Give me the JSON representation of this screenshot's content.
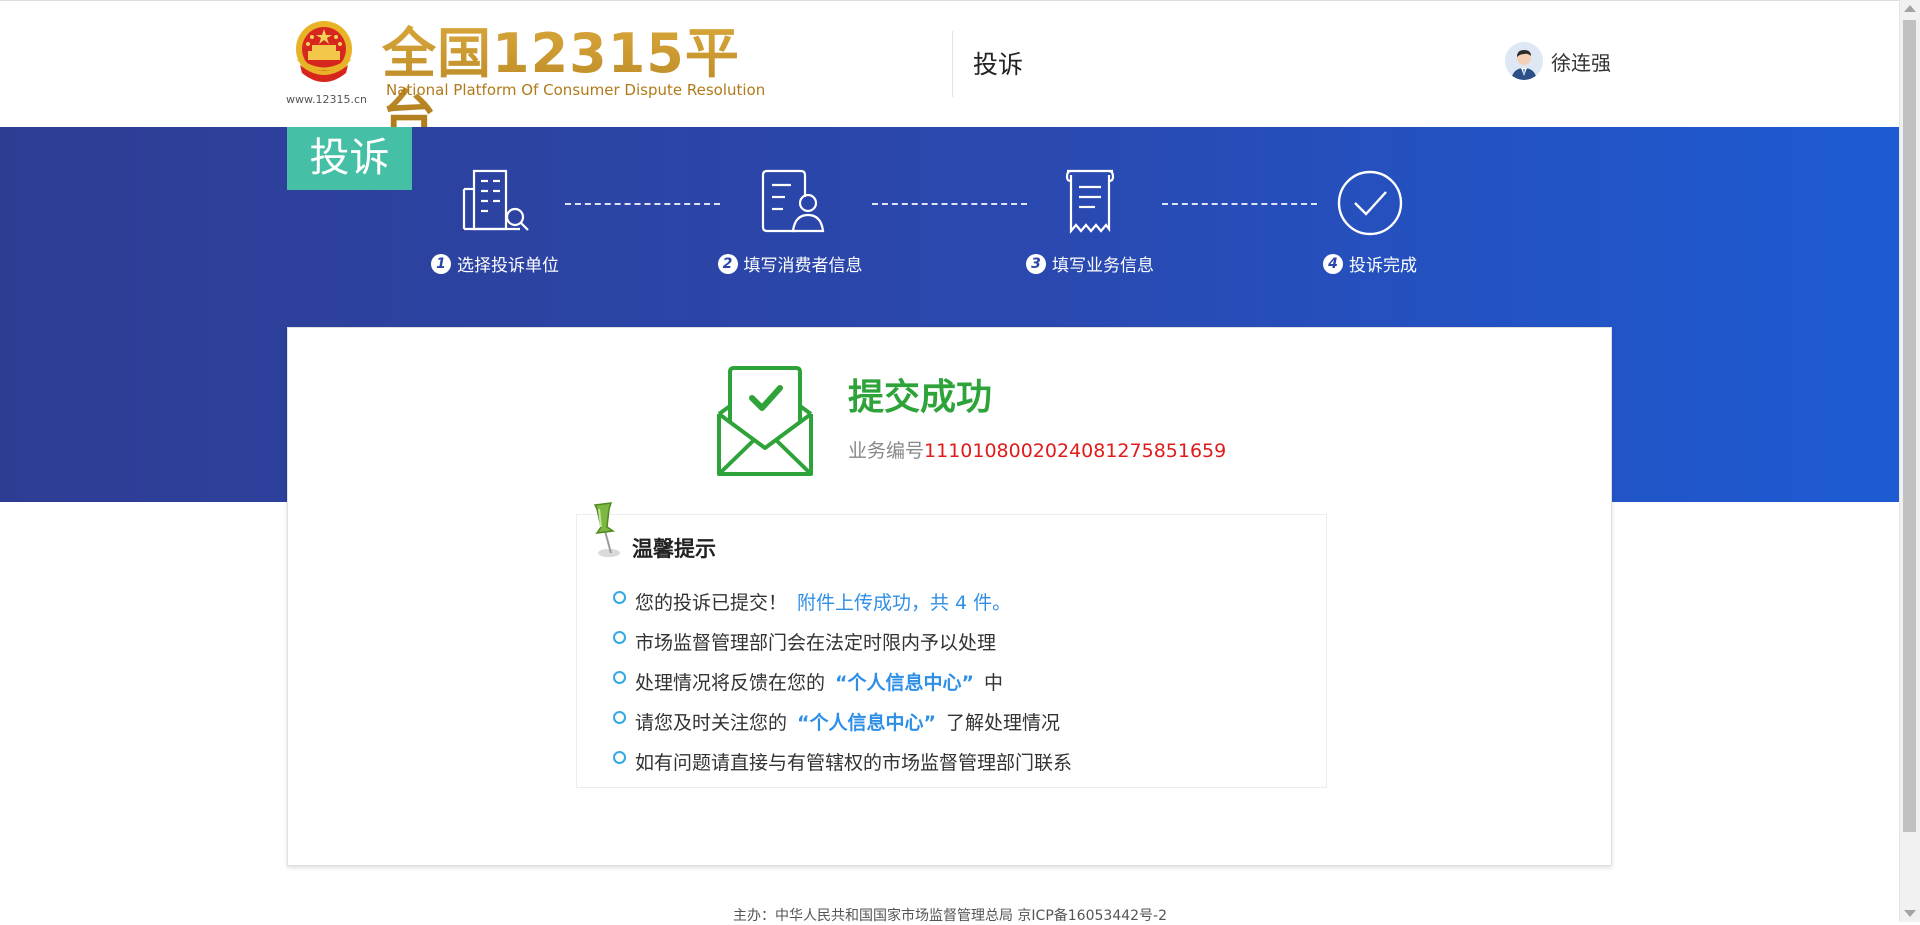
{
  "header": {
    "logo_url": "www.12315.cn",
    "logo_title": "全国12315平台",
    "logo_subtitle": "National Platform Of Consumer Dispute Resolution",
    "page_title": "投诉",
    "user_name": "徐连强"
  },
  "banner": {
    "tag": "投诉",
    "steps": [
      {
        "num": "1",
        "label": "选择投诉单位",
        "icon": "building-search-icon"
      },
      {
        "num": "2",
        "label": "填写消费者信息",
        "icon": "user-form-icon"
      },
      {
        "num": "3",
        "label": "填写业务信息",
        "icon": "receipt-icon"
      },
      {
        "num": "4",
        "label": "投诉完成",
        "icon": "check-circle-icon"
      }
    ]
  },
  "result": {
    "title": "提交成功",
    "biz_label": "业务编号",
    "biz_number": "1110108002024081275851659"
  },
  "tips": {
    "title": "温馨提示",
    "items": [
      {
        "text": "您的投诉已提交！",
        "highlight": "附件上传成功，共 4 件。"
      },
      {
        "text": "市场监督管理部门会在法定时限内予以处理"
      },
      {
        "pre": "处理情况将反馈在您的",
        "link": "“个人信息中心”",
        "post": "中"
      },
      {
        "pre": "请您及时关注您的",
        "link": "“个人信息中心”",
        "post": "了解处理情况"
      },
      {
        "text": "如有问题请直接与有管辖权的市场监督管理部门联系"
      }
    ]
  },
  "footer": {
    "text": "主办：中华人民共和国国家市场监督管理总局 京ICP备16053442号-2"
  },
  "colors": {
    "banner_start": "#2e3d94",
    "banner_end": "#1d5bd3",
    "tag_bg": "#45bfa5",
    "success_green": "#2ea33a",
    "number_red": "#e01b1b",
    "link_blue": "#2f8fe6"
  }
}
